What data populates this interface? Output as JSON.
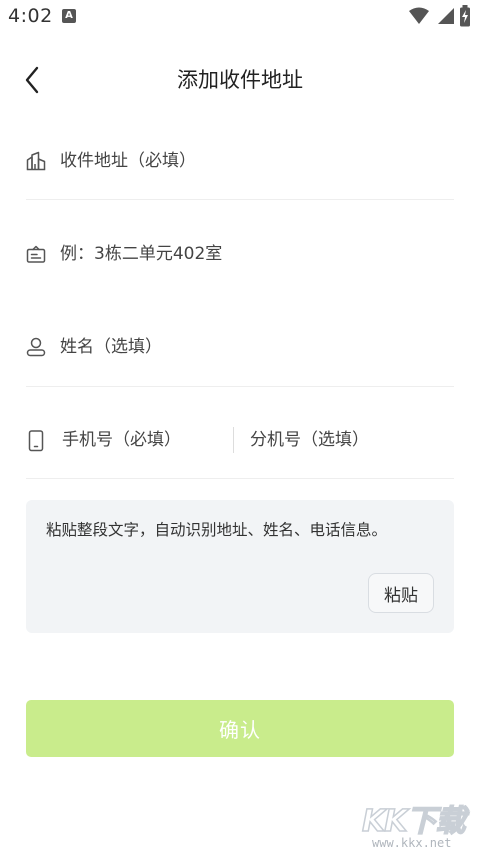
{
  "status_bar": {
    "time": "4:02",
    "notification_letter": "A"
  },
  "header": {
    "title": "添加收件地址"
  },
  "form": {
    "address": {
      "placeholder": "收件地址（必填）",
      "icon": "building-icon"
    },
    "detail": {
      "placeholder": "例：3栋二单元402室",
      "icon": "door-plate-icon"
    },
    "name": {
      "placeholder": "姓名（选填）",
      "icon": "person-icon"
    },
    "phone": {
      "placeholder": "手机号（必填）",
      "icon": "phone-icon"
    },
    "extension": {
      "placeholder": "分机号（选填）"
    }
  },
  "paste": {
    "placeholder": "粘贴整段文字，自动识别地址、姓名、电话信息。",
    "button_label": "粘贴"
  },
  "confirm": {
    "label": "确认",
    "color": "#c9ec8c"
  },
  "watermark": {
    "logo": "KK下载",
    "url": "www.kkx.net"
  }
}
